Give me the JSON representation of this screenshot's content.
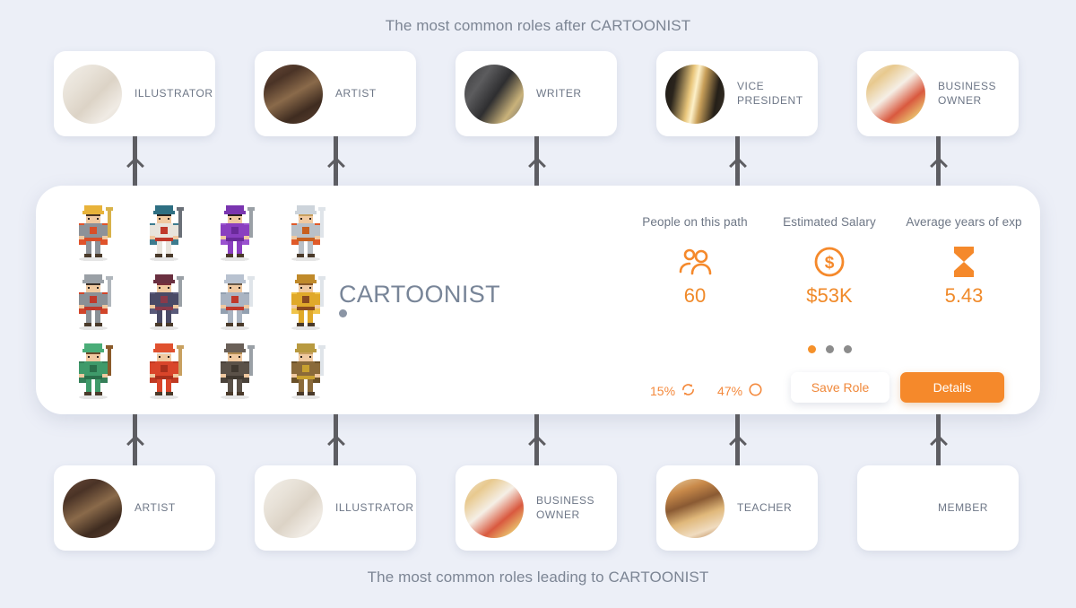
{
  "captions": {
    "top": "The most common roles after CARTOONIST",
    "bottom": "The most common roles leading to CARTOONIST"
  },
  "colors": {
    "background": "#eceff7",
    "accent": "#f5892b",
    "card": "#ffffff",
    "text_muted": "#6e7787",
    "connector": "#5d5d62",
    "dot_inactive": "#8c8c8c"
  },
  "next_roles": [
    {
      "label": "ILLUSTRATOR",
      "icon": "illustrator-desk-photo"
    },
    {
      "label": "ARTIST",
      "icon": "artist-paint-shelf-photo"
    },
    {
      "label": "WRITER",
      "icon": "writer-desk-keyboard-photo"
    },
    {
      "label": "VICE\nPRESIDENT",
      "icon": "office-lobby-photo"
    },
    {
      "label": "BUSINESS\nOWNER",
      "icon": "business-owner-laptop-photo"
    }
  ],
  "previous_roles": [
    {
      "label": "ARTIST",
      "icon": "artist-paint-shelf-photo"
    },
    {
      "label": "ILLUSTRATOR",
      "icon": "illustrator-desk-photo"
    },
    {
      "label": "BUSINESS\nOWNER",
      "icon": "business-owner-laptop-photo"
    },
    {
      "label": "TEACHER",
      "icon": "classroom-photo"
    },
    {
      "label": "MEMBER",
      "icon": "raised-hands-photo"
    }
  ],
  "main_card": {
    "role_title": "CARTOONIST",
    "stats": [
      {
        "label": "People on this path",
        "value": "60",
        "icon": "people-icon"
      },
      {
        "label": "Estimated Salary",
        "value": "$53K",
        "icon": "dollar-circle-icon"
      },
      {
        "label": "Average years of exp",
        "value": "5.43",
        "icon": "hourglass-icon"
      }
    ],
    "carousel": {
      "total": 3,
      "active_index": 0
    },
    "percentages": [
      {
        "value": "15%",
        "icon": "refresh-cycle-icon"
      },
      {
        "value": "47%",
        "icon": "circle-outline-icon"
      }
    ],
    "buttons": {
      "save": "Save Role",
      "details": "Details"
    },
    "sprites": [
      "king-knight-violin",
      "bishop-cleric-staff",
      "purple-wizard",
      "silver-knight-plume",
      "spear-crusader",
      "rogue-duelist",
      "blue-knight-shield",
      "golden-eagle-warrior",
      "green-archer",
      "red-wizard-staff",
      "brown-haired-rogue",
      "viking-berserker"
    ]
  }
}
